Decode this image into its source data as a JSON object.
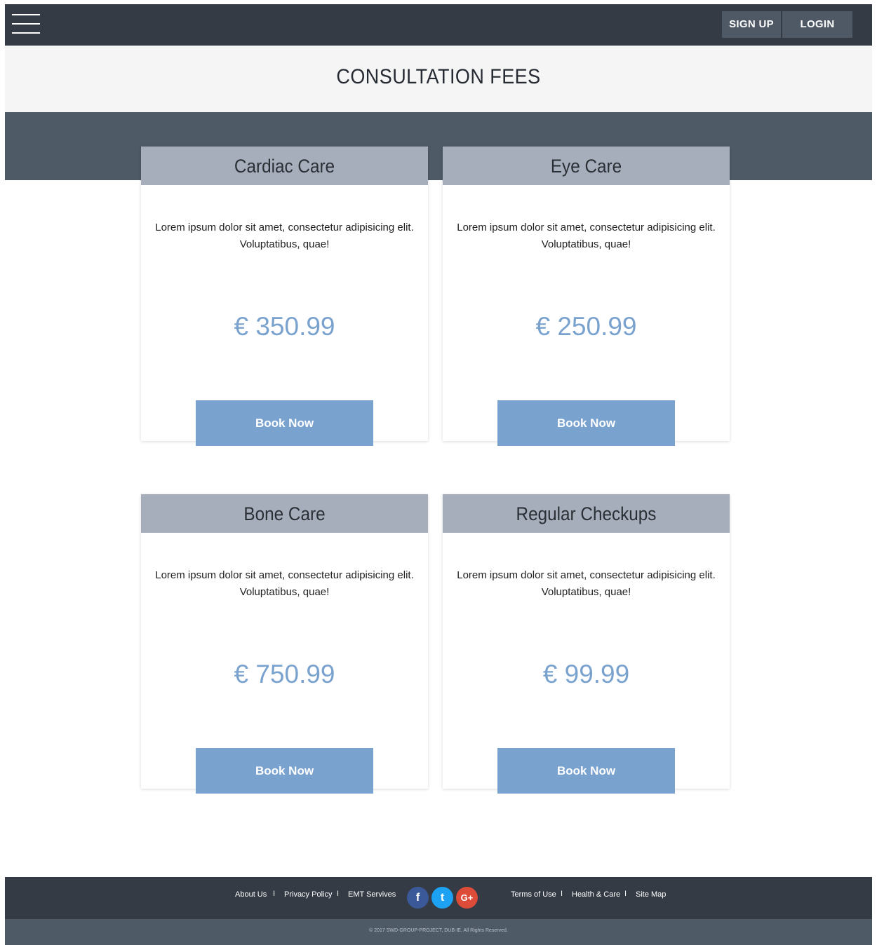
{
  "header": {
    "menu_icon": "hamburger-icon",
    "signup_label": "SIGN UP",
    "login_label": "LOGIN"
  },
  "page": {
    "title": "CONSULTATION FEES"
  },
  "cards": [
    {
      "title": "Cardiac Care",
      "description": "Lorem ipsum dolor sit amet, consectetur adipisicing elit. Voluptatibus, quae!",
      "price": "€ 350.99",
      "button_label": "Book Now"
    },
    {
      "title": "Eye Care",
      "description": "Lorem ipsum dolor sit amet, consectetur adipisicing elit. Voluptatibus, quae!",
      "price": "€ 250.99",
      "button_label": "Book Now"
    },
    {
      "title": "Bone Care",
      "description": "Lorem ipsum dolor sit amet, consectetur adipisicing elit. Voluptatibus, quae!",
      "price": "€ 750.99",
      "button_label": "Book Now"
    },
    {
      "title": "Regular Checkups",
      "description": "Lorem ipsum dolor sit amet, consectetur adipisicing elit. Voluptatibus, quae!",
      "price": "€ 99.99",
      "button_label": "Book Now"
    }
  ],
  "footer": {
    "links_left": [
      "About Us",
      "Privacy Policy",
      "EMT Servives"
    ],
    "links_right": [
      "Terms of Use",
      "Health & Care",
      "Site Map"
    ],
    "separator": "I",
    "social": [
      {
        "icon": "facebook-icon",
        "glyph": "f",
        "color": "#3b5998"
      },
      {
        "icon": "twitter-icon",
        "glyph": "t",
        "color": "#1da1f2"
      },
      {
        "icon": "google-plus-icon",
        "glyph": "G+",
        "color": "#dd4b39"
      }
    ],
    "copyright": "© 2017 SWD-GROUP-PROJECT, DUB-IE. All Rights Reserved."
  },
  "colors": {
    "header_bg": "#343b45",
    "accent": "#7aa2cf",
    "card_header": "#a7aebb",
    "band": "#4e5a66"
  }
}
